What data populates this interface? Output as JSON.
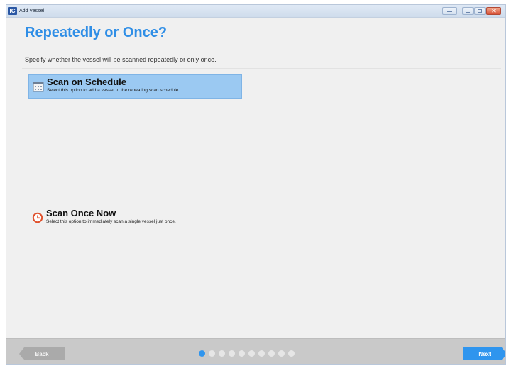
{
  "window": {
    "app_icon_text": "IC",
    "title": "Add Vessel"
  },
  "page": {
    "title": "Repeatedly or Once?",
    "subtitle": "Specify whether the vessel will be scanned repeatedly or only once."
  },
  "options": [
    {
      "title": "Scan on Schedule",
      "description": "Select this option to add a vessel to the repeating scan schedule.",
      "icon": "calendar-icon",
      "selected": true
    },
    {
      "title": "Scan Once Now",
      "description": "Select this option to immediately scan a single vessel just once.",
      "icon": "clock-icon",
      "selected": false
    }
  ],
  "footer": {
    "back_label": "Back",
    "next_label": "Next",
    "steps_total": 10,
    "current_step": 1
  },
  "colors": {
    "accent": "#2f95ee",
    "title_blue": "#2f8ee6",
    "selected_bg": "#9bc9f2",
    "close_red": "#d9553a"
  }
}
